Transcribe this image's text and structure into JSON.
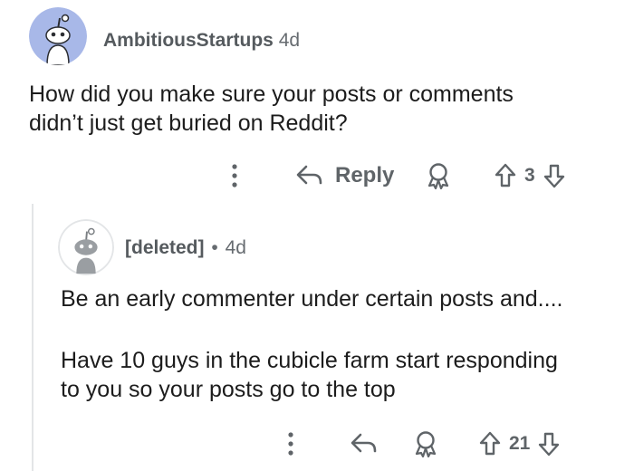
{
  "comment": {
    "username": "AmbitiousStartups",
    "age": "4d",
    "text_lines": [
      "How did you make sure your posts or comments",
      "didn’t just get buried on Reddit?"
    ],
    "actions": {
      "more_icon": "more-vertical-icon",
      "reply_icon": "reply-arrow-icon",
      "reply_label": "Reply",
      "award_icon": "award-icon",
      "upvote_icon": "upvote-arrow-icon",
      "vote_count": "3",
      "downvote_icon": "downvote-arrow-icon"
    },
    "avatar_color": "#a8b8e8"
  },
  "reply": {
    "username": "[deleted]",
    "separator": "•",
    "age": "4d",
    "text_lines_1": [
      "Be an early commenter under certain posts and...."
    ],
    "text_lines_2": [
      "Have 10 guys in the cubicle farm start responding",
      "to you so your posts go to the top"
    ],
    "actions": {
      "more_icon": "more-vertical-icon",
      "reply_icon": "reply-arrow-icon",
      "award_icon": "award-icon",
      "upvote_icon": "upvote-arrow-icon",
      "vote_count": "21",
      "downvote_icon": "downvote-arrow-icon"
    },
    "avatar_color": "#e9eaec"
  }
}
